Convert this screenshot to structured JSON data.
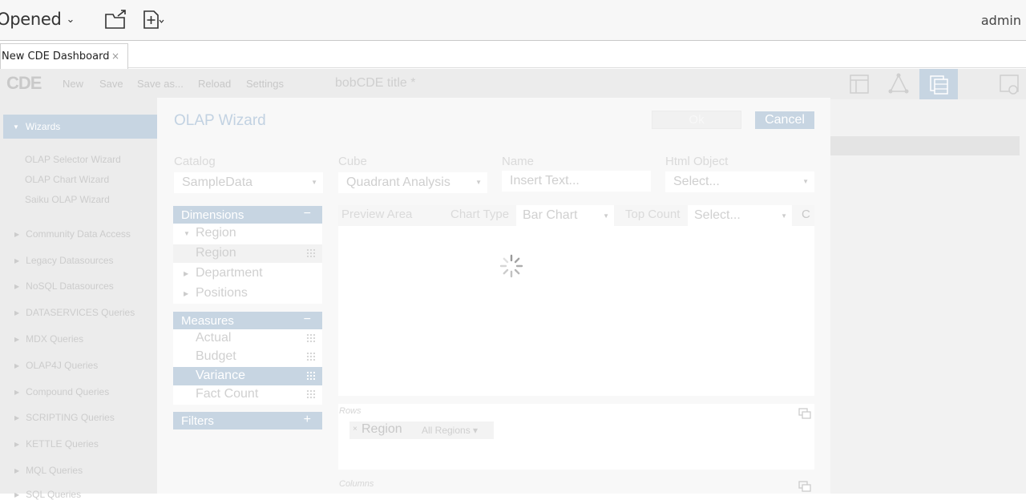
{
  "topbar": {
    "opened_label": "Opened",
    "user": "admin"
  },
  "tab": {
    "title": "New CDE Dashboard",
    "close": "×"
  },
  "cde": {
    "logo": "CDE",
    "menu": [
      "New",
      "Save",
      "Save as...",
      "Reload",
      "Settings"
    ],
    "dashboard_title": "bobCDE title *"
  },
  "sidebar": {
    "wizards_label": "Wizards",
    "wizards": [
      "OLAP Selector Wizard",
      "OLAP Chart Wizard",
      "Saiku OLAP Wizard"
    ],
    "groups": [
      "Community Data Access",
      "Legacy Datasources",
      "NoSQL Datasources",
      "DATASERVICES Queries",
      "MDX Queries",
      "OLAP4J Queries",
      "Compound Queries",
      "SCRIPTING Queries",
      "KETTLE Queries",
      "MQL Queries",
      "SQL Queries"
    ]
  },
  "modal": {
    "title": "OLAP Wizard",
    "ok": "Ok",
    "cancel": "Cancel",
    "catalog": {
      "label": "Catalog",
      "value": "SampleData"
    },
    "cube": {
      "label": "Cube",
      "value": "Quadrant Analysis"
    },
    "name": {
      "label": "Name",
      "placeholder": "Insert Text..."
    },
    "html_object": {
      "label": "Html Object",
      "value": "Select..."
    },
    "dimensions": {
      "label": "Dimensions",
      "toggle": "−",
      "items": [
        {
          "label": "Region",
          "type": "folder"
        },
        {
          "label": "Region",
          "type": "leaf"
        },
        {
          "label": "Department",
          "type": "collapsed"
        },
        {
          "label": "Positions",
          "type": "collapsed"
        }
      ]
    },
    "measures": {
      "label": "Measures",
      "toggle": "−",
      "items": [
        "Actual",
        "Budget",
        "Variance",
        "Fact Count"
      ],
      "selected": "Variance"
    },
    "filters": {
      "label": "Filters",
      "toggle": "+"
    },
    "preview": {
      "label": "Preview Area",
      "chart_type_label": "Chart Type",
      "chart_type": "Bar Chart",
      "top_count_label": "Top Count",
      "top_count": "Select...",
      "refresh": "C"
    },
    "rows": {
      "label": "Rows",
      "chip": "Region",
      "chip_filter": "All Regions ▾"
    },
    "columns": {
      "label": "Columns"
    }
  }
}
